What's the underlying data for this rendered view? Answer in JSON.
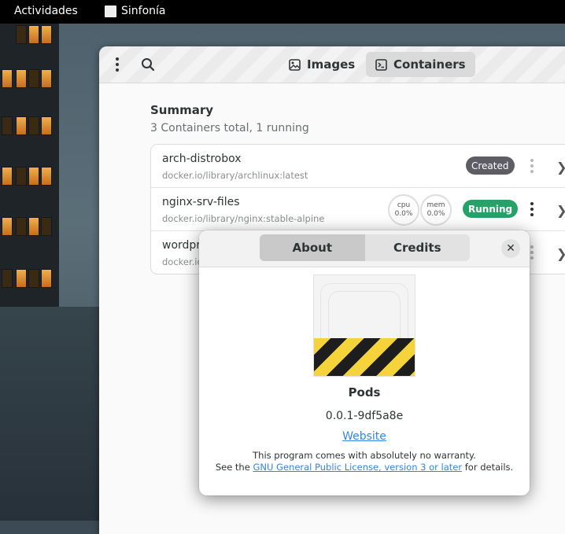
{
  "topbar": {
    "activities": "Actividades",
    "app_name": "Sinfonía"
  },
  "header": {
    "tabs": [
      {
        "label": "Images",
        "icon": "image-icon",
        "active": false
      },
      {
        "label": "Containers",
        "icon": "terminal-icon",
        "active": true
      }
    ]
  },
  "summary": {
    "title": "Summary",
    "subtitle": "3 Containers total,  1 running"
  },
  "containers": [
    {
      "name": "arch-distrobox",
      "image": "docker.io/library/archlinux:latest",
      "status": "Created"
    },
    {
      "name": "nginx-srv-files",
      "image": "docker.io/library/nginx:stable-alpine",
      "status": "Running",
      "cpu_label": "cpu",
      "cpu_value": "0.0%",
      "mem_label": "mem",
      "mem_value": "0.0%"
    },
    {
      "name": "wordpr",
      "image": "docker.io"
    }
  ],
  "dialog": {
    "tabs": [
      {
        "label": "About",
        "active": true
      },
      {
        "label": "Credits",
        "active": false
      }
    ],
    "app_name": "Pods",
    "version": "0.0.1-9df5a8e",
    "website": "Website",
    "legal_line1": "This program comes with absolutely no warranty.",
    "legal_prefix": "See the",
    "license_link": "GNU General Public License, version 3 or later",
    "legal_suffix": "for details."
  },
  "colors": {
    "running": "#26a269",
    "created": "#5e5c64",
    "link": "#3584e4"
  }
}
